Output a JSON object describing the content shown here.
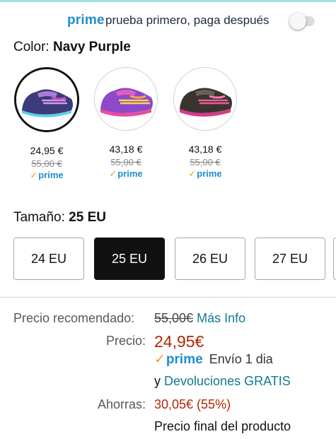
{
  "prime_banner": {
    "brand": "prime",
    "tagline": "prueba primero, paga después",
    "toggle_on": false
  },
  "color": {
    "label": "Color:",
    "selected": "Navy Purple",
    "options": [
      {
        "price": "24,95 €",
        "old_price": "55,00 €",
        "badge": "prime"
      },
      {
        "price": "43,18 €",
        "old_price": "55,00 €",
        "badge": "prime"
      },
      {
        "price": "43,18 €",
        "old_price": "55,00 €",
        "badge": "prime"
      }
    ]
  },
  "size": {
    "label": "Tamaño:",
    "selected": "25 EU",
    "options": [
      "24 EU",
      "25 EU",
      "26 EU",
      "27 EU"
    ]
  },
  "pricing": {
    "recommended_label": "Precio recomendado:",
    "recommended_value": "55,00€",
    "more_info": "Más Info",
    "price_label": "Precio:",
    "price_value": "24,95€",
    "prime_badge": "prime",
    "shipping": "Envío 1 dia",
    "and": "y",
    "returns": "Devoluciones GRATIS",
    "savings_label": "Ahorras:",
    "savings_value": "30,05€ (55%)",
    "final_note": "Precio final del producto"
  },
  "colors": {
    "prime_blue": "#1f8ec9",
    "link_teal": "#0f7c90",
    "price_red": "#b12704",
    "check_orange": "#f0a21a"
  }
}
